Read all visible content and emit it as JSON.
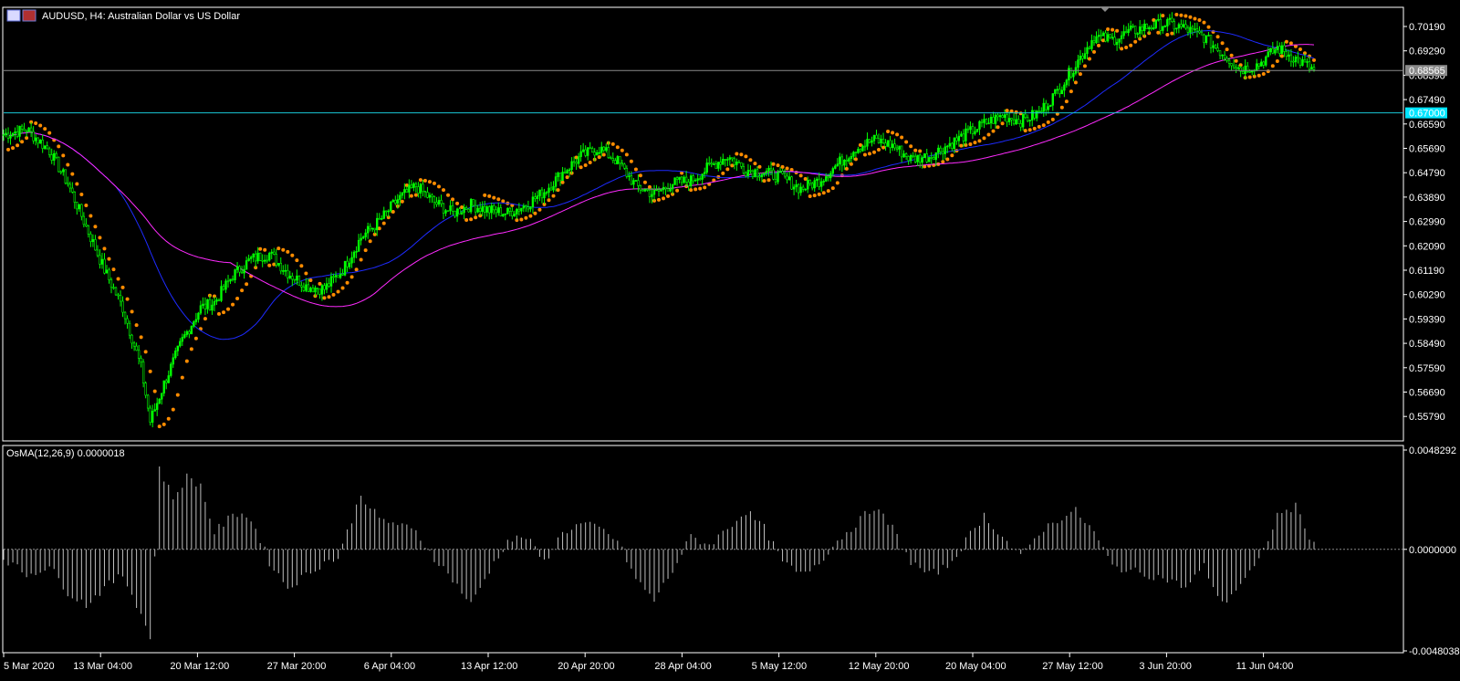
{
  "symbol_label": "AUDUSD, H4:  Australian Dollar vs US Dollar",
  "colors": {
    "background": "#000000",
    "frame": "#ffffff",
    "bull_candle": "#00ff00",
    "bear_candle": "#00ff00",
    "sar": "#ff8c00",
    "ma_fast": "#1e2bff",
    "ma_slow": "#ff2bff",
    "hline_bid": "#8a8a8a",
    "hline_level": "#19c7d6",
    "bid_tag_bg": "#8a8a8a",
    "level_tag_bg": "#00e5ff",
    "osma_bar": "#bfbfbf",
    "zero_line": "#8a8a8a"
  },
  "price_axis_ticks": [
    "0.70190",
    "0.69290",
    "0.68390",
    "0.67490",
    "0.66590",
    "0.65690",
    "0.64790",
    "0.63890",
    "0.62990",
    "0.62090",
    "0.61190",
    "0.60290",
    "0.59390",
    "0.58490",
    "0.57590",
    "0.56690",
    "0.55790"
  ],
  "bid_tag": "0.68565",
  "level_tag": "0.67000",
  "time_axis_labels": [
    "5 Mar 2020",
    "13 Mar 04:00",
    "20 Mar 12:00",
    "27 Mar 20:00",
    "6 Apr 04:00",
    "13 Apr 12:00",
    "20 Apr 20:00",
    "28 Apr 04:00",
    "5 May 12:00",
    "12 May 20:00",
    "20 May 04:00",
    "27 May 12:00",
    "3 Jun 20:00",
    "11 Jun 04:00"
  ],
  "osma": {
    "label": "OsMA(12,26,9) 0.0000018",
    "axis_ticks": [
      "0.0048292",
      "0.0000000",
      "-0.0048038"
    ]
  },
  "chart_data": [
    {
      "type": "candlestick",
      "title": "AUDUSD, H4:  Australian Dollar vs US Dollar",
      "ylim": [
        0.552,
        0.706
      ],
      "overlays": [
        "Parabolic SAR",
        "Moving Average (fast, blue)",
        "Moving Average (slow, magenta)"
      ],
      "horizontal_lines": [
        0.68565,
        0.67
      ],
      "x_labels": [
        "5 Mar 2020",
        "13 Mar 04:00",
        "20 Mar 12:00",
        "27 Mar 20:00",
        "6 Apr 04:00",
        "13 Apr 12:00",
        "20 Apr 20:00",
        "28 Apr 04:00",
        "5 May 12:00",
        "12 May 20:00",
        "20 May 04:00",
        "27 May 12:00",
        "3 Jun 20:00",
        "11 Jun 04:00"
      ],
      "close_path_anchors": [
        [
          0,
          0.662
        ],
        [
          10,
          0.664
        ],
        [
          20,
          0.656
        ],
        [
          28,
          0.644
        ],
        [
          36,
          0.628
        ],
        [
          44,
          0.612
        ],
        [
          52,
          0.598
        ],
        [
          60,
          0.576
        ],
        [
          64,
          0.556
        ],
        [
          70,
          0.57
        ],
        [
          78,
          0.586
        ],
        [
          86,
          0.598
        ],
        [
          92,
          0.6
        ],
        [
          100,
          0.61
        ],
        [
          108,
          0.616
        ],
        [
          116,
          0.618
        ],
        [
          124,
          0.611
        ],
        [
          132,
          0.606
        ],
        [
          140,
          0.605
        ],
        [
          148,
          0.612
        ],
        [
          156,
          0.624
        ],
        [
          164,
          0.63
        ],
        [
          172,
          0.638
        ],
        [
          180,
          0.643
        ],
        [
          188,
          0.637
        ],
        [
          196,
          0.633
        ],
        [
          204,
          0.636
        ],
        [
          212,
          0.634
        ],
        [
          220,
          0.633
        ],
        [
          228,
          0.636
        ],
        [
          236,
          0.641
        ],
        [
          244,
          0.648
        ],
        [
          252,
          0.654
        ],
        [
          260,
          0.657
        ],
        [
          268,
          0.652
        ],
        [
          276,
          0.643
        ],
        [
          284,
          0.64
        ],
        [
          292,
          0.644
        ],
        [
          300,
          0.645
        ],
        [
          308,
          0.65
        ],
        [
          316,
          0.654
        ],
        [
          324,
          0.649
        ],
        [
          332,
          0.648
        ],
        [
          340,
          0.646
        ],
        [
          348,
          0.642
        ],
        [
          356,
          0.645
        ],
        [
          364,
          0.651
        ],
        [
          372,
          0.657
        ],
        [
          380,
          0.66
        ],
        [
          388,
          0.658
        ],
        [
          396,
          0.653
        ],
        [
          404,
          0.654
        ],
        [
          412,
          0.658
        ],
        [
          420,
          0.662
        ],
        [
          428,
          0.666
        ],
        [
          436,
          0.669
        ],
        [
          444,
          0.667
        ],
        [
          452,
          0.67
        ],
        [
          460,
          0.678
        ],
        [
          468,
          0.688
        ],
        [
          476,
          0.698
        ],
        [
          484,
          0.697
        ],
        [
          492,
          0.7
        ],
        [
          500,
          0.702
        ],
        [
          508,
          0.703
        ],
        [
          516,
          0.701
        ],
        [
          524,
          0.698
        ],
        [
          532,
          0.692
        ],
        [
          540,
          0.686
        ],
        [
          548,
          0.688
        ],
        [
          556,
          0.694
        ],
        [
          564,
          0.69
        ],
        [
          572,
          0.6856
        ]
      ],
      "bar_count": 573
    },
    {
      "type": "bar",
      "title": "OsMA(12,26,9) 0.0000018",
      "ylim": [
        -0.0048038,
        0.0048292
      ],
      "anchors": [
        [
          0,
          -0.0004
        ],
        [
          10,
          -0.0012
        ],
        [
          20,
          -0.0008
        ],
        [
          28,
          -0.002
        ],
        [
          36,
          -0.0026
        ],
        [
          44,
          -0.0018
        ],
        [
          52,
          -0.0012
        ],
        [
          60,
          -0.003
        ],
        [
          64,
          -0.0042
        ],
        [
          68,
          0.0038
        ],
        [
          74,
          0.0024
        ],
        [
          80,
          0.0034
        ],
        [
          86,
          0.003
        ],
        [
          92,
          0.0008
        ],
        [
          98,
          0.0014
        ],
        [
          104,
          0.0018
        ],
        [
          110,
          0.001
        ],
        [
          116,
          -0.0006
        ],
        [
          124,
          -0.0018
        ],
        [
          132,
          -0.0012
        ],
        [
          140,
          -0.0006
        ],
        [
          146,
          -0.0004
        ],
        [
          150,
          0.0008
        ],
        [
          156,
          0.0026
        ],
        [
          164,
          0.0014
        ],
        [
          172,
          0.0012
        ],
        [
          180,
          0.0008
        ],
        [
          188,
          -0.0004
        ],
        [
          196,
          -0.0014
        ],
        [
          204,
          -0.0026
        ],
        [
          212,
          -0.001
        ],
        [
          220,
          0.0004
        ],
        [
          228,
          0.0006
        ],
        [
          236,
          -0.0006
        ],
        [
          244,
          0.0008
        ],
        [
          252,
          0.0012
        ],
        [
          260,
          0.001
        ],
        [
          268,
          0.0004
        ],
        [
          276,
          -0.0014
        ],
        [
          284,
          -0.0024
        ],
        [
          292,
          -0.001
        ],
        [
          300,
          0.0006
        ],
        [
          308,
          0.0002
        ],
        [
          316,
          0.001
        ],
        [
          324,
          0.0018
        ],
        [
          332,
          0.001
        ],
        [
          340,
          -0.0006
        ],
        [
          348,
          -0.0012
        ],
        [
          356,
          -0.0006
        ],
        [
          364,
          0.0004
        ],
        [
          372,
          0.0012
        ],
        [
          380,
          0.002
        ],
        [
          388,
          0.001
        ],
        [
          396,
          -0.0006
        ],
        [
          404,
          -0.0012
        ],
        [
          412,
          -0.0008
        ],
        [
          420,
          0.0004
        ],
        [
          428,
          0.0016
        ],
        [
          436,
          0.0006
        ],
        [
          444,
          -0.0004
        ],
        [
          452,
          0.0008
        ],
        [
          460,
          0.0014
        ],
        [
          468,
          0.0018
        ],
        [
          476,
          0.0008
        ],
        [
          484,
          -0.0008
        ],
        [
          492,
          -0.001
        ],
        [
          500,
          -0.0012
        ],
        [
          508,
          -0.0014
        ],
        [
          516,
          -0.0018
        ],
        [
          524,
          -0.0008
        ],
        [
          532,
          -0.0026
        ],
        [
          540,
          -0.0016
        ],
        [
          548,
          -0.0006
        ],
        [
          556,
          0.0016
        ],
        [
          564,
          0.002
        ],
        [
          572,
          0.0002
        ]
      ],
      "bar_count": 573
    }
  ]
}
